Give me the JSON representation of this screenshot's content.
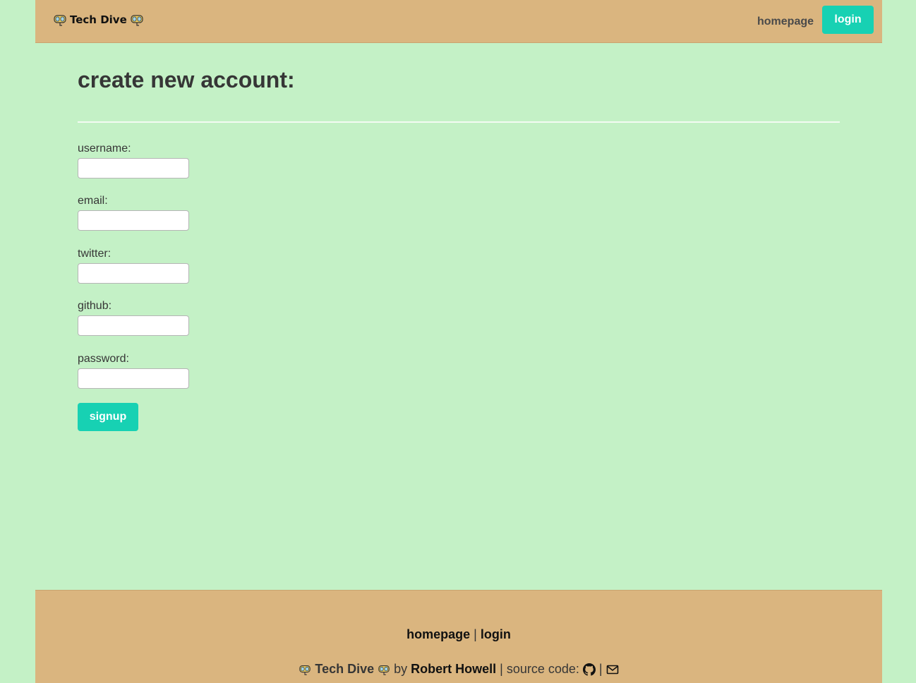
{
  "header": {
    "brand": "Tech Dive",
    "nav_homepage": "homepage",
    "nav_login": "login"
  },
  "main": {
    "title": "create new account:",
    "fields": [
      {
        "label": "username:",
        "value": ""
      },
      {
        "label": "email:",
        "value": ""
      },
      {
        "label": "twitter:",
        "value": ""
      },
      {
        "label": "github:",
        "value": ""
      },
      {
        "label": "password:",
        "value": ""
      }
    ],
    "signup_label": "signup"
  },
  "footer": {
    "link_homepage": "homepage",
    "separator": "|",
    "link_login": "login",
    "brand": "Tech Dive",
    "by": "by",
    "author": "Robert Howell",
    "source_code": "| source code:",
    "separator2": "|"
  },
  "icons": {
    "brand": "diving-mask-icon",
    "source": "github-icon",
    "contact": "envelope-icon"
  },
  "colors": {
    "background": "#c4f1c6",
    "bar": "#dab57f",
    "accent": "#17d1b3"
  }
}
